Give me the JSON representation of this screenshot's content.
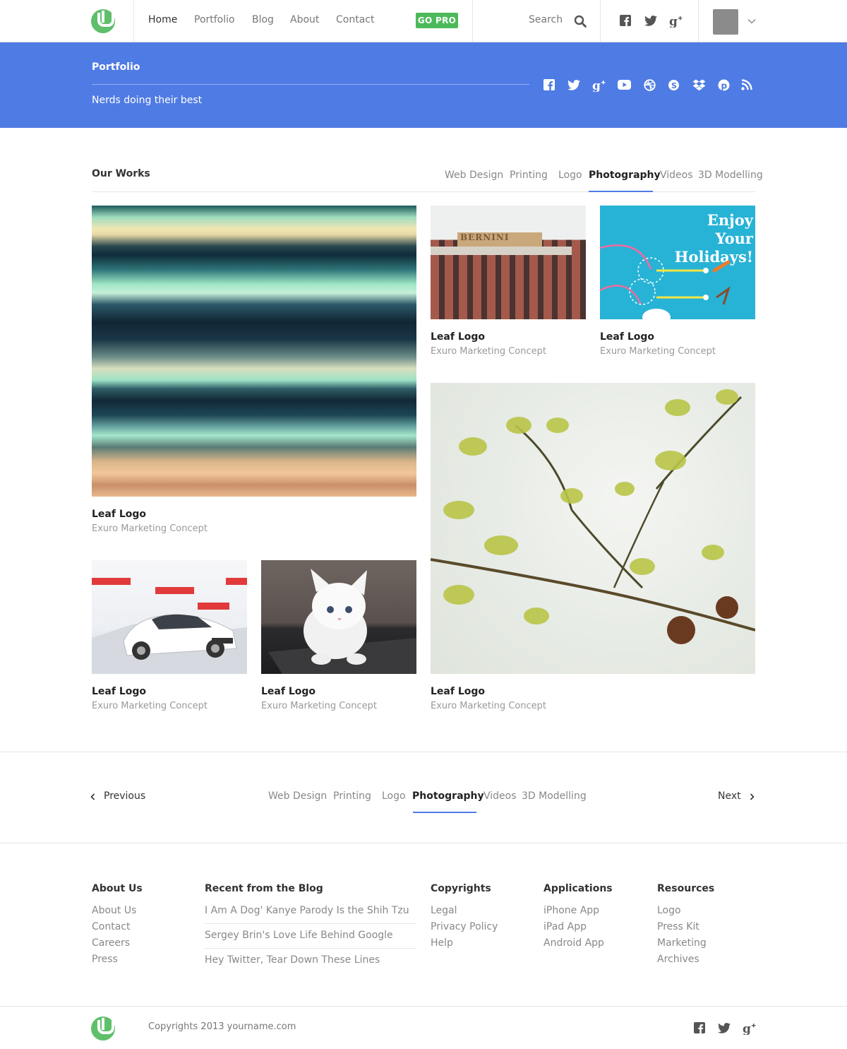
{
  "header": {
    "nav": [
      {
        "label": "Home"
      },
      {
        "label": "Portfolio"
      },
      {
        "label": "Blog"
      },
      {
        "label": "About"
      },
      {
        "label": "Contact"
      }
    ],
    "go_pro": "GO PRO",
    "search_label": "Search",
    "social_icons": [
      "facebook-icon",
      "twitter-icon",
      "google-plus-icon"
    ]
  },
  "banner": {
    "title": "Portfolio",
    "subtitle": "Nerds doing their best",
    "social_icons": [
      "facebook-icon",
      "twitter-icon",
      "google-plus-icon",
      "youtube-icon",
      "dribbble-icon",
      "skype-icon",
      "dropbox-icon",
      "pinterest-icon",
      "rss-icon"
    ]
  },
  "works": {
    "title": "Our Works",
    "tabs": [
      "Web Design",
      "Printing",
      "Logo",
      "Photography",
      "Videos",
      "3D Modelling"
    ],
    "active_tab": "Photography",
    "items": [
      {
        "title": "Leaf Logo",
        "subtitle": "Exuro Marketing Concept"
      },
      {
        "title": "Leaf Logo",
        "subtitle": "Exuro Marketing Concept"
      },
      {
        "title": "Leaf Logo",
        "subtitle": "Exuro Marketing Concept"
      },
      {
        "title": "Leaf Logo",
        "subtitle": "Exuro Marketing Concept"
      },
      {
        "title": "Leaf Logo",
        "subtitle": "Exuro Marketing Concept"
      },
      {
        "title": "Leaf Logo",
        "subtitle": "Exuro Marketing Concept"
      }
    ],
    "holiday_text": "Enjoy Your Holidays!",
    "building_sign": "BERNINI"
  },
  "pager": {
    "previous": "Previous",
    "next": "Next",
    "tabs": [
      "Web Design",
      "Printing",
      "Logo",
      "Photography",
      "Videos",
      "3D Modelling"
    ]
  },
  "footer": {
    "columns": [
      {
        "heading": "About Us",
        "links": [
          "About Us",
          "Contact",
          "Careers",
          "Press"
        ]
      },
      {
        "heading": "Recent from the Blog",
        "links": [
          "I Am A Dog' Kanye Parody Is the Shih Tzu",
          "Sergey Brin's Love Life Behind Google",
          "Hey Twitter, Tear Down These Lines"
        ]
      },
      {
        "heading": "Copyrights",
        "links": [
          "Legal",
          "Privacy Policy",
          "Help"
        ]
      },
      {
        "heading": "Applications",
        "links": [
          "iPhone App",
          "iPad App",
          "Android App"
        ]
      },
      {
        "heading": "Resources",
        "links": [
          "Logo",
          "Press Kit",
          "Marketing",
          "Archives"
        ]
      }
    ],
    "copyright": "Copyrights 2013 yourname.com",
    "social_icons": [
      "facebook-icon",
      "twitter-icon",
      "google-plus-icon"
    ]
  },
  "colors": {
    "accent": "#4f7be4",
    "brand_green": "#5fbf6b",
    "go_pro_green": "#4cba5b"
  }
}
